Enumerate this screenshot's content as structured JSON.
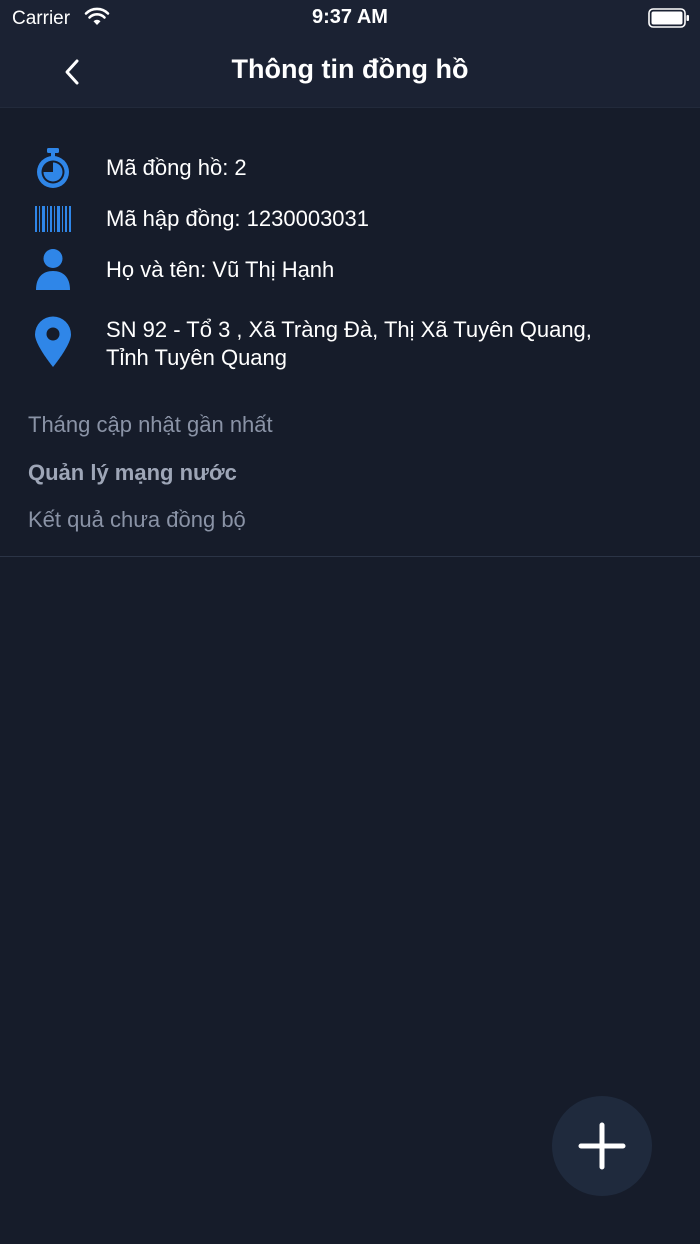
{
  "status_bar": {
    "carrier": "Carrier",
    "time": "9:37 AM",
    "wifi_icon": "wifi-icon",
    "battery_icon": "battery-icon"
  },
  "nav": {
    "title": "Thông tin đồng hồ",
    "back_icon": "chevron-left-icon"
  },
  "info": {
    "meter_code": "Mã đồng hồ: 2",
    "contract_code": "Mã hập đồng: 1230003031",
    "full_name": "Họ và tên: Vũ Thị Hạnh",
    "address_line1": "SN 92 - Tổ 3 , Xã Tràng Đà, Thị Xã Tuyên Quang,",
    "address_line2": "Tỉnh Tuyên Quang"
  },
  "sections": {
    "last_update": "Tháng cập nhật gần nhất",
    "network_management": "Quản lý mạng nước",
    "unsynced_results": "Kết quả chưa đồng bộ"
  },
  "fab": {
    "icon": "plus-icon"
  },
  "colors": {
    "background": "#161c2a",
    "bar": "#1b2233",
    "accent_blue": "#2f86e8",
    "muted_text": "#8a93a6"
  }
}
